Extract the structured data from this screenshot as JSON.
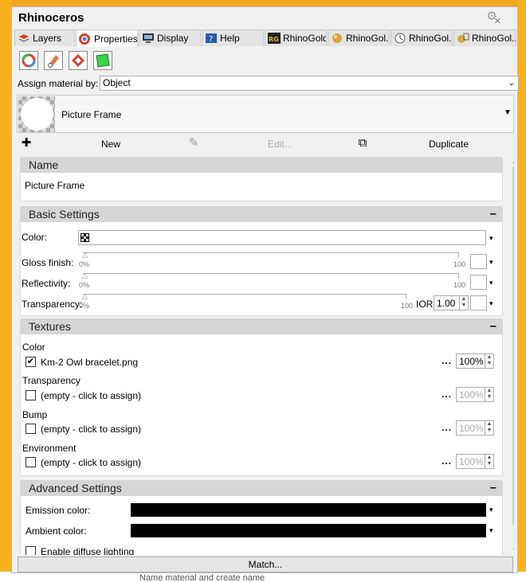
{
  "window": {
    "title": "Rhinoceros"
  },
  "tabs": [
    {
      "label": "Layers",
      "icon": "layers-icon"
    },
    {
      "label": "Properties",
      "icon": "properties-icon",
      "active": true
    },
    {
      "label": "Display",
      "icon": "display-icon"
    },
    {
      "label": "Help",
      "icon": "help-icon"
    },
    {
      "label": "RhinoGold",
      "icon": "rhinogold-icon"
    },
    {
      "label": "RhinoGol...",
      "icon": "rhinogold-gem-icon"
    },
    {
      "label": "RhinoGol...",
      "icon": "rhinogold-dial-icon"
    },
    {
      "label": "RhinoGol...",
      "icon": "rhinogold-tools-icon"
    }
  ],
  "assign": {
    "label": "Assign material by:",
    "value": "Object"
  },
  "material": {
    "name": "Picture Frame"
  },
  "actions": {
    "new": "New",
    "edit": "Edit...",
    "duplicate": "Duplicate"
  },
  "name_section": {
    "title": "Name",
    "value": "Picture Frame"
  },
  "basic": {
    "title": "Basic Settings",
    "color_label": "Color:",
    "gloss_label": "Gloss finish:",
    "reflect_label": "Reflectivity:",
    "transp_label": "Transparency:",
    "min": "0%",
    "max": "100",
    "ior_label": "IOR:",
    "ior_value": "1.00"
  },
  "textures": {
    "title": "Textures",
    "color": {
      "title": "Color",
      "file": "Km-2 Owl bracelet.png",
      "checked": true,
      "percent": "100%"
    },
    "transparency": {
      "title": "Transparency",
      "file": "(empty - click to assign)",
      "percent": "100%"
    },
    "bump": {
      "title": "Bump",
      "file": "(empty - click to assign)",
      "percent": "100%"
    },
    "environment": {
      "title": "Environment",
      "file": "(empty - click to assign)",
      "percent": "100%"
    },
    "dots": "..."
  },
  "advanced": {
    "title": "Advanced Settings",
    "emission_label": "Emission color:",
    "ambient_label": "Ambient color:",
    "diffuse_label": "Enable diffuse lighting"
  },
  "match_label": "Match...",
  "background_text": "Name material and create name",
  "colors": {
    "accent_orange": "#f7b21c",
    "section_header": "#d6d6d6"
  }
}
